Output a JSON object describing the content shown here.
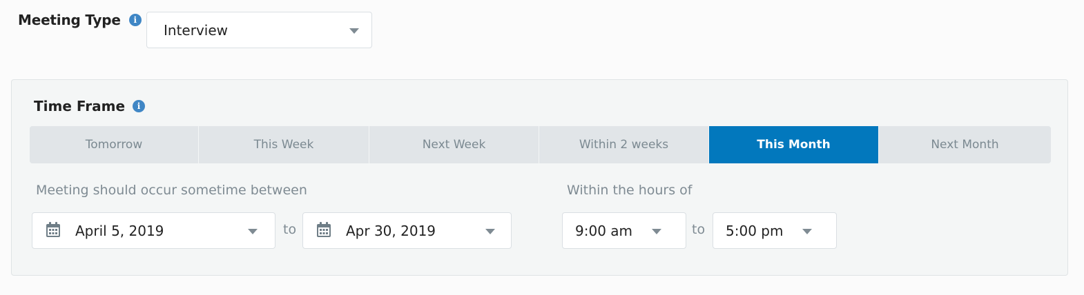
{
  "meeting_type": {
    "label": "Meeting Type",
    "info_icon": "info-icon",
    "selected": "Interview"
  },
  "time_frame": {
    "title": "Time Frame",
    "info_icon": "info-icon",
    "tabs": [
      {
        "label": "Tomorrow",
        "active": false
      },
      {
        "label": "This Week",
        "active": false
      },
      {
        "label": "Next Week",
        "active": false
      },
      {
        "label": "Within 2 weeks",
        "active": false
      },
      {
        "label": "This Month",
        "active": true
      },
      {
        "label": "Next Month",
        "active": false
      }
    ],
    "between_label": "Meeting should occur sometime between",
    "start_date": "April 5, 2019",
    "date_separator": "to",
    "end_date": "Apr 30, 2019",
    "hours_label": "Within the hours of",
    "start_time": "9:00 am",
    "time_separator": "to",
    "end_time": "5:00 pm"
  },
  "colors": {
    "accent": "#0278bd",
    "info_icon": "#3f86c5",
    "muted_text": "#7f8b93",
    "tab_bg": "#e1e5e8"
  }
}
